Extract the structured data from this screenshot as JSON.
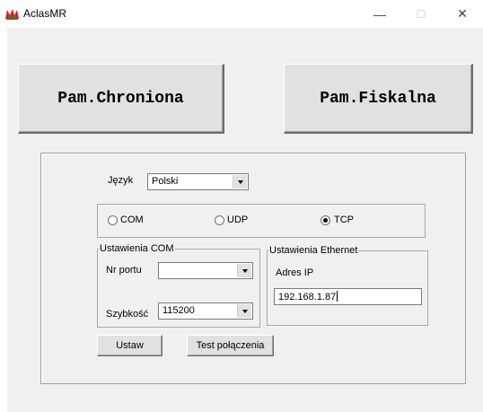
{
  "window": {
    "title": "AclasMR",
    "minimize": "—",
    "maximize": "☐",
    "close": "✕",
    "icon": "app-logo-icon"
  },
  "buttons": {
    "pam_chroniona": "Pam.Chroniona",
    "pam_fiskalna": "Pam.Fiskalna",
    "ustaw": "Ustaw",
    "test": "Test połączenia"
  },
  "language": {
    "label": "Język",
    "value": "Polski"
  },
  "connection": {
    "options": [
      {
        "label": "COM",
        "selected": false
      },
      {
        "label": "UDP",
        "selected": false
      },
      {
        "label": "TCP",
        "selected": true
      }
    ]
  },
  "com_settings": {
    "legend": "Ustawienia COM",
    "port_label": "Nr portu",
    "port_value": "",
    "speed_label": "Szybkość",
    "speed_value": "115200"
  },
  "ethernet_settings": {
    "legend": "Ustawienia Ethernet",
    "ip_label": "Adres IP",
    "ip_value": "192.168.1.87"
  }
}
